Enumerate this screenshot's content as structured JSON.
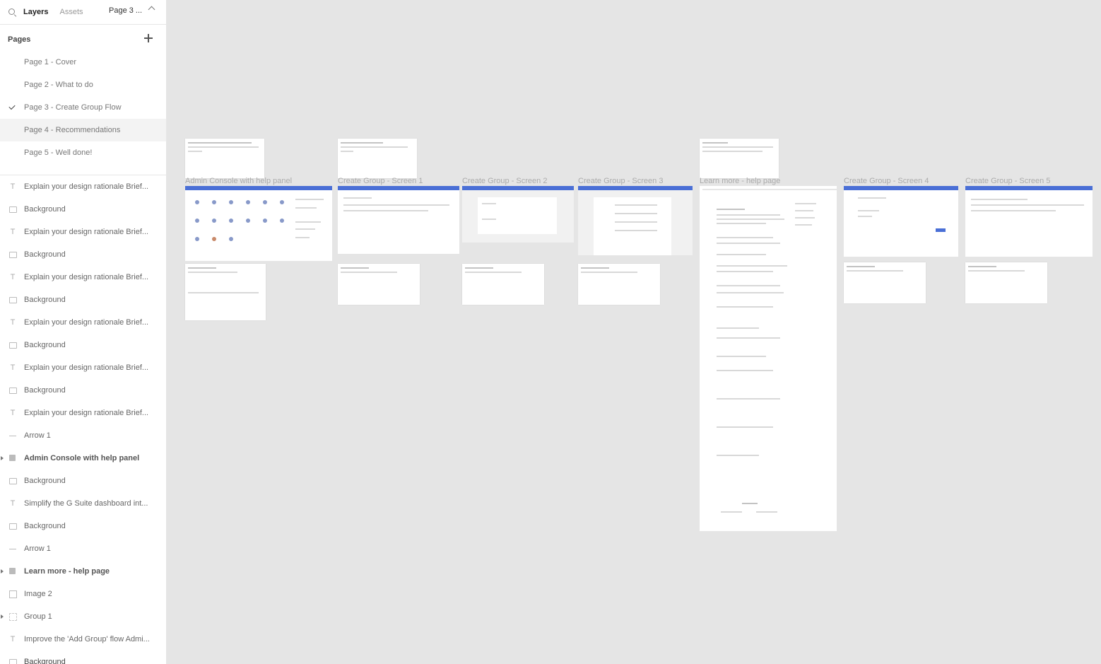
{
  "sidebar": {
    "tabs": {
      "layers": "Layers",
      "assets": "Assets"
    },
    "current_page": "Page 3 ...",
    "pages_header": "Pages",
    "pages": [
      {
        "label": "Page 1 - Cover",
        "selected": false
      },
      {
        "label": "Page 2 - What to do",
        "selected": false
      },
      {
        "label": "Page 3 - Create Group Flow",
        "selected": false,
        "checked": true
      },
      {
        "label": "Page 4 - Recommendations",
        "selected": true
      },
      {
        "label": "Page 5 - Well done!",
        "selected": false
      }
    ],
    "layers": [
      {
        "label": "Explain your design rationale Brief...",
        "icon": "text"
      },
      {
        "label": "Background",
        "icon": "rect"
      },
      {
        "label": "Explain your design rationale Brief...",
        "icon": "text"
      },
      {
        "label": "Background",
        "icon": "rect"
      },
      {
        "label": "Explain your design rationale Brief...",
        "icon": "text"
      },
      {
        "label": "Background",
        "icon": "rect"
      },
      {
        "label": "Explain your design rationale Brief...",
        "icon": "text"
      },
      {
        "label": "Background",
        "icon": "rect"
      },
      {
        "label": "Explain your design rationale Brief...",
        "icon": "text"
      },
      {
        "label": "Background",
        "icon": "rect"
      },
      {
        "label": "Explain your design rationale Brief...",
        "icon": "text"
      },
      {
        "label": "Arrow 1",
        "icon": "line"
      },
      {
        "label": "Admin Console with help panel",
        "icon": "frame",
        "bold": true,
        "expandable": true
      },
      {
        "label": "Background",
        "icon": "rect"
      },
      {
        "label": "Simplify the G Suite dashboard int...",
        "icon": "text"
      },
      {
        "label": "Background",
        "icon": "rect"
      },
      {
        "label": "Arrow 1",
        "icon": "line"
      },
      {
        "label": "Learn more - help page",
        "icon": "frame",
        "bold": true,
        "expandable": true
      },
      {
        "label": "Image 2",
        "icon": "image"
      },
      {
        "label": "Group 1",
        "icon": "group",
        "expandable": true
      },
      {
        "label": "Improve the 'Add Group' flow Admi...",
        "icon": "text"
      },
      {
        "label": "Background",
        "icon": "rect"
      }
    ]
  },
  "canvas": {
    "frames": [
      {
        "label": "Admin Console with help panel"
      },
      {
        "label": "Create Group - Screen 1"
      },
      {
        "label": "Create Group - Screen 2"
      },
      {
        "label": "Create Group - Screen 3"
      },
      {
        "label": "Learn more - help page"
      },
      {
        "label": "Create Group - Screen 4"
      },
      {
        "label": "Create Group - Screen 5"
      }
    ]
  }
}
